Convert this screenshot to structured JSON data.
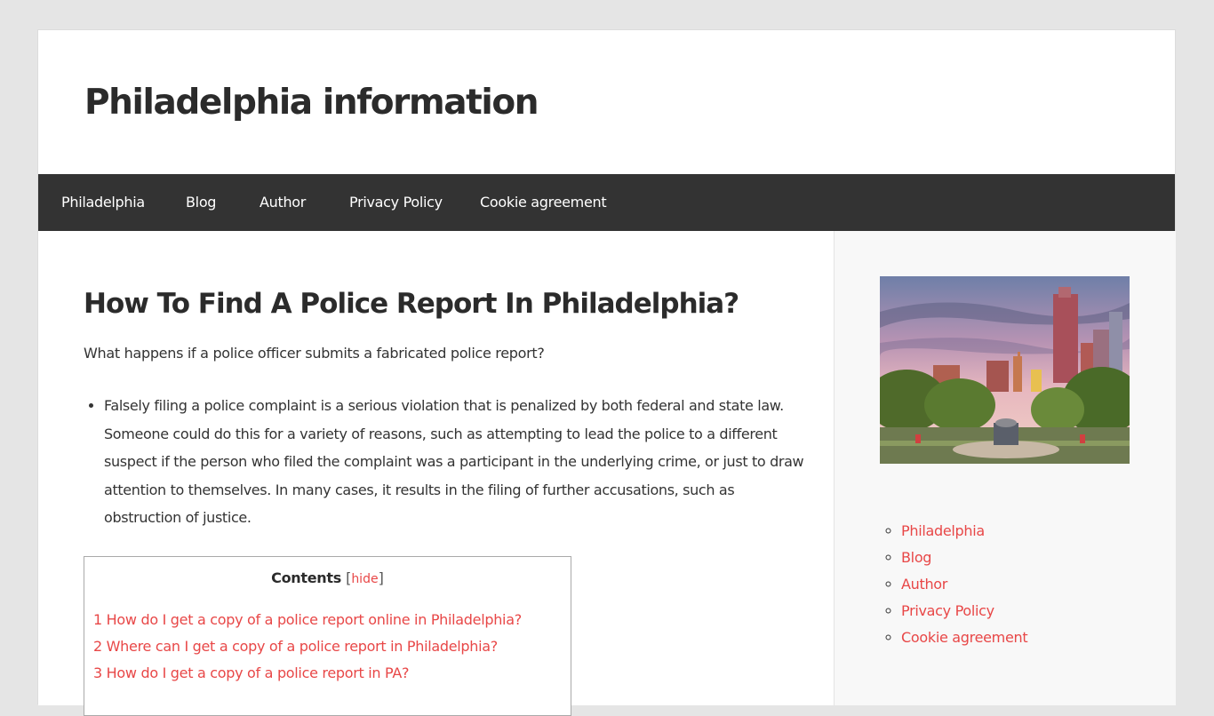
{
  "site": {
    "title": "Philadelphia information"
  },
  "nav": {
    "items": [
      "Philadelphia",
      "Blog",
      "Author",
      "Privacy Policy",
      "Cookie agreement"
    ]
  },
  "post": {
    "title": "How To Find A Police Report In Philadelphia?",
    "intro": "What happens if a police officer submits a fabricated police report?",
    "bullet": "Falsely filing a police complaint is a serious violation that is penalized by both federal and state law. Someone could do this for a variety of reasons, such as attempting to lead the police to a different suspect if the person who filed the complaint was a participant in the underlying crime, or just to draw attention to themselves. In many cases, it results in the filing of further accusations, such as obstruction of justice."
  },
  "toc": {
    "label": "Contents",
    "bracket_open": "[",
    "hide": "hide",
    "bracket_close": "]",
    "items": [
      "1 How do I get a copy of a police report online in Philadelphia?",
      "2 Where can I get a copy of a police report in Philadelphia?",
      "3 How do I get a copy of a police report in PA?"
    ]
  },
  "sidebar": {
    "links": [
      "Philadelphia",
      "Blog",
      "Author",
      "Privacy Policy",
      "Cookie agreement"
    ]
  },
  "colors": {
    "accent": "#e84747",
    "nav_bg": "#333333",
    "page_bg": "#e5e5e5"
  }
}
